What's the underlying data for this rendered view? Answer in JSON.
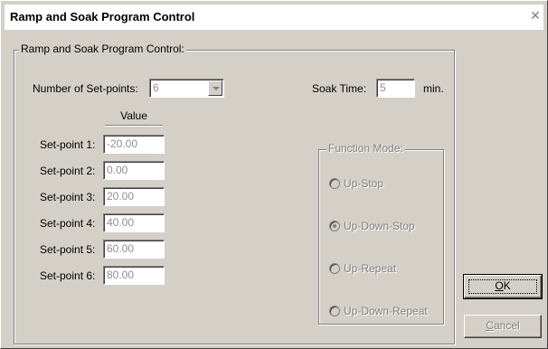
{
  "window": {
    "title": "Ramp and Soak Program Control",
    "close_glyph": "✕"
  },
  "program_group": {
    "legend": "Ramp and Soak Program Control:",
    "num_setpoints_label": "Number of Set-points:",
    "num_setpoints_value": "6",
    "soak_time_label": "Soak Time:",
    "soak_time_value": "5",
    "soak_time_unit": "min.",
    "value_header": "Value",
    "setpoints": [
      {
        "label": "Set-point 1:",
        "value": "-20.00"
      },
      {
        "label": "Set-point 2:",
        "value": "0.00"
      },
      {
        "label": "Set-point 3:",
        "value": "20.00"
      },
      {
        "label": "Set-point 4:",
        "value": "40.00"
      },
      {
        "label": "Set-point 5:",
        "value": "60.00"
      },
      {
        "label": "Set-point 6:",
        "value": "80.00"
      }
    ]
  },
  "function_mode": {
    "legend": "Function Mode:",
    "options": [
      {
        "label": "Up-Stop",
        "checked": false
      },
      {
        "label": "Up-Down-Stop",
        "checked": true
      },
      {
        "label": "Up-Repeat",
        "checked": false
      },
      {
        "label": "Up-Down-Repeat",
        "checked": false
      }
    ]
  },
  "buttons": {
    "ok_mnemonic": "O",
    "ok_rest": "K",
    "cancel_mnemonic": "C",
    "cancel_rest": "ancel"
  },
  "colors": {
    "face": "#d4d0c8",
    "disabled_text": "#808080",
    "titlebar": "#ffffff"
  }
}
